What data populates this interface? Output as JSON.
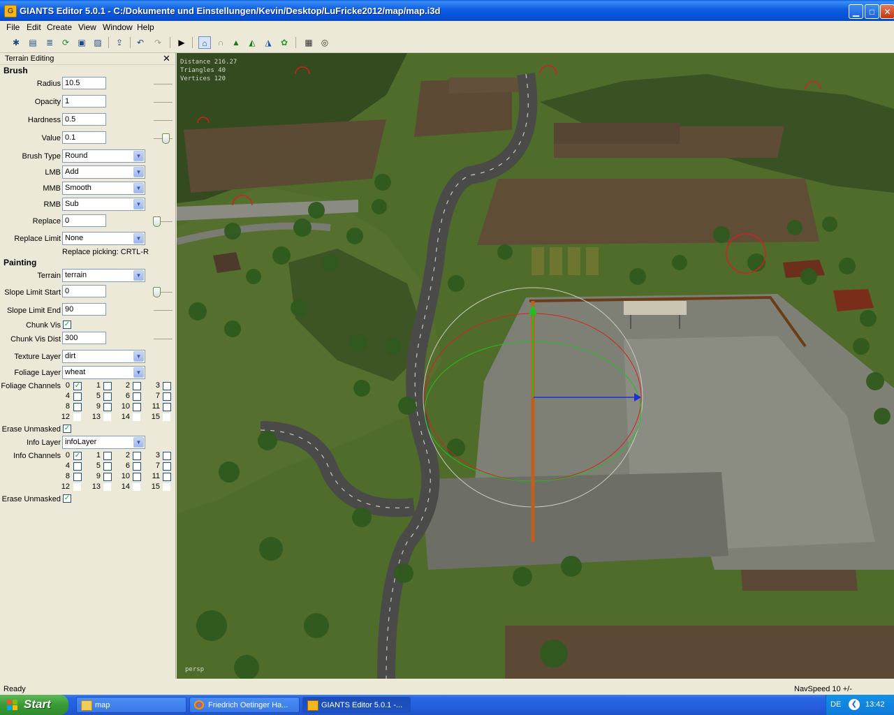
{
  "window": {
    "title": "GIANTS Editor 5.0.1 - C:/Dokumente und Einstellungen/Kevin/Desktop/LuFricke2012/map/map.i3d",
    "app_icon_letter": "G",
    "minimize": "▁",
    "maximize": "□",
    "close": "✕"
  },
  "menu": [
    "File",
    "Edit",
    "Create",
    "View",
    "Window",
    "Help"
  ],
  "toolbar": {
    "icons": [
      "new-icon",
      "open-icon",
      "document-icon",
      "refresh-icon",
      "save-icon",
      "save-as-icon",
      "import-icon",
      "undo-icon",
      "redo-icon",
      "play-icon",
      "select-mode-icon",
      "move-mode-icon",
      "terrain-sculpt-icon",
      "terrain-paint-icon",
      "terrain-texture-icon",
      "foliage-icon",
      "terrain-check-icon",
      "navigation-icon"
    ]
  },
  "panel": {
    "title": "Terrain Editing",
    "close": "✕",
    "brush": {
      "heading": "Brush",
      "radius_label": "Radius",
      "radius": "10.5",
      "opacity_label": "Opacity",
      "opacity": "1",
      "hardness_label": "Hardness",
      "hardness": "0.5",
      "value_label": "Value",
      "value": "0.1",
      "brush_type_label": "Brush Type",
      "brush_type": "Round",
      "lmb_label": "LMB",
      "lmb": "Add",
      "mmb_label": "MMB",
      "mmb": "Smooth",
      "rmb_label": "RMB",
      "rmb": "Sub",
      "replace_label": "Replace",
      "replace": "0",
      "replace_limit_label": "Replace Limit",
      "replace_limit": "None",
      "replace_picking": "Replace picking: CRTL-R"
    },
    "painting": {
      "heading": "Painting",
      "terrain_label": "Terrain",
      "terrain": "terrain",
      "slope_start_label": "Slope Limit Start",
      "slope_start": "0",
      "slope_end_label": "Slope Limit End",
      "slope_end": "90",
      "chunk_vis_label": "Chunk Vis",
      "chunk_vis_dist_label": "Chunk Vis Dist",
      "chunk_vis_dist": "300",
      "texture_layer_label": "Texture Layer",
      "texture_layer": "dirt",
      "foliage_layer_label": "Foliage Layer",
      "foliage_layer": "wheat",
      "foliage_channels_label": "Foliage Channels",
      "erase_unmasked_label": "Erase Unmasked",
      "info_layer_label": "Info Layer",
      "info_layer": "infoLayer",
      "info_channels_label": "Info Channels",
      "erase_unmasked2_label": "Erase Unmasked"
    },
    "channel_numbers": [
      "0",
      "1",
      "2",
      "3",
      "4",
      "5",
      "6",
      "7",
      "8",
      "9",
      "10",
      "11",
      "12",
      "13",
      "14",
      "15"
    ]
  },
  "viewport": {
    "distance": "Distance 216.27",
    "triangles": "Triangles 40",
    "vertices": "Vertices 120",
    "camera": "persp"
  },
  "status": {
    "left": "Ready",
    "right": "NavSpeed 10 +/-"
  },
  "taskbar": {
    "start": "Start",
    "tasks": [
      "map",
      "Friedrich Oetinger Ha...",
      "GIANTS Editor 5.0.1 -..."
    ],
    "lang": "DE",
    "time": "13:42"
  },
  "colors": {
    "accent": "#0a5fe4",
    "check": "#21a121",
    "gizmo_red": "#d42020",
    "gizmo_green": "#20c020",
    "gizmo_blue": "#2030d0"
  }
}
